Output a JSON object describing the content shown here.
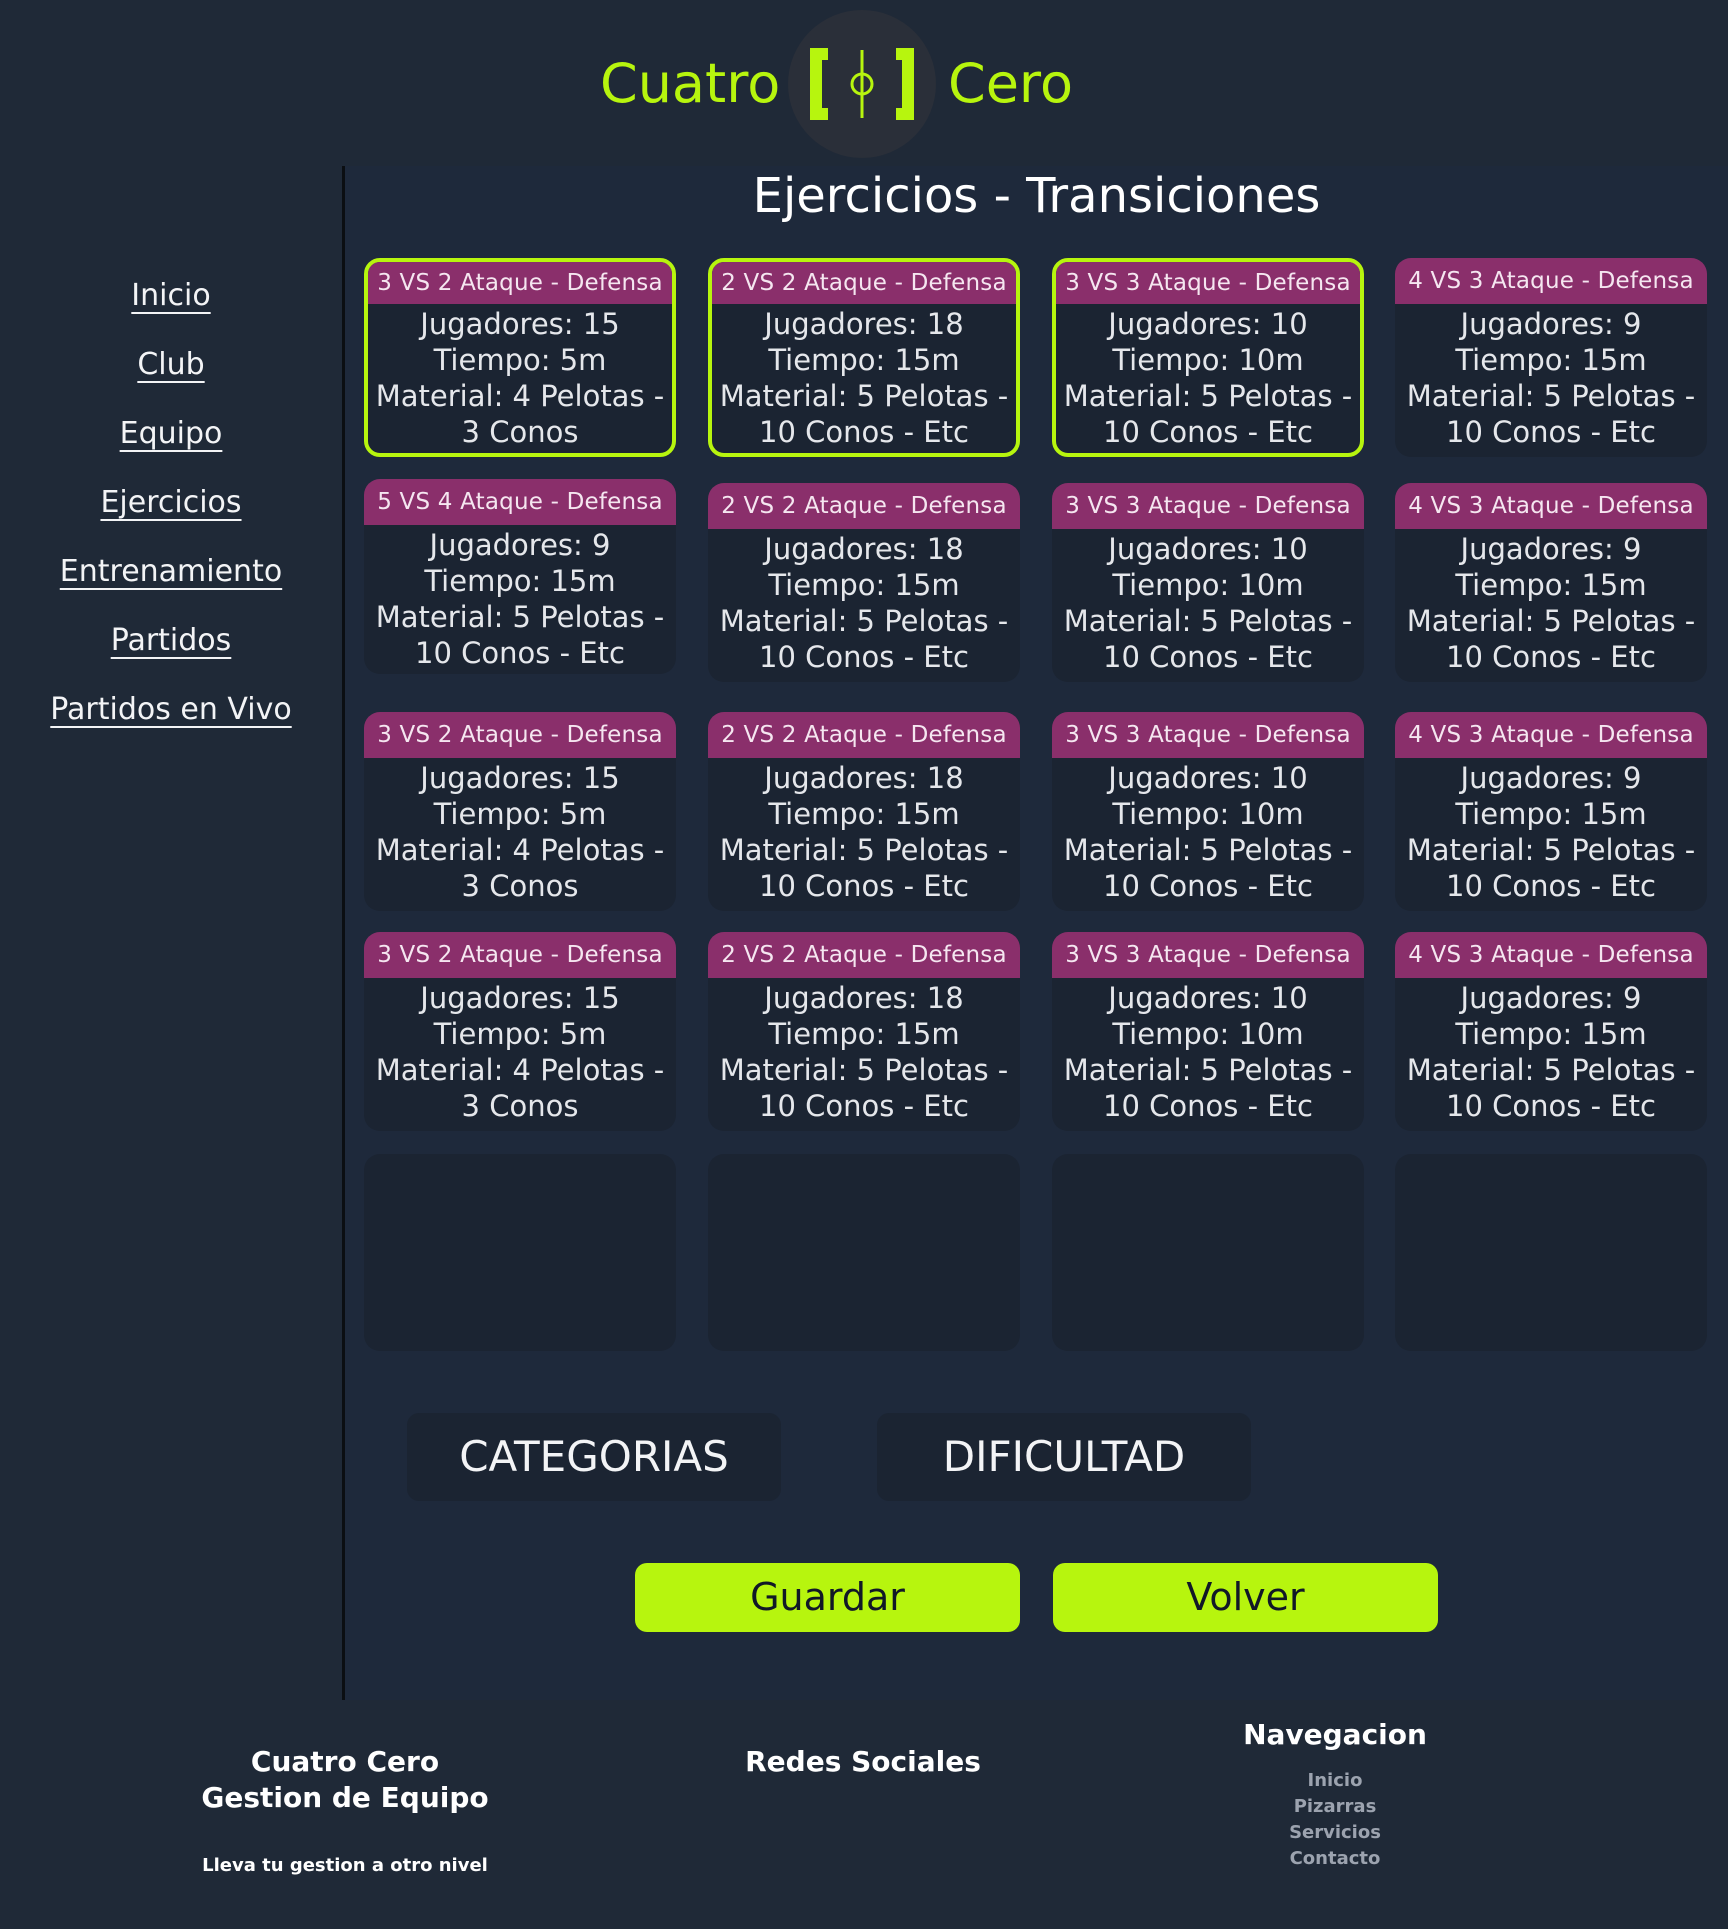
{
  "brand": {
    "left": "Cuatro",
    "right": "Cero",
    "accent": "#b7f50e",
    "logo_icon": "goal-brackets-icon"
  },
  "page": {
    "title": "Ejercicios - Transiciones"
  },
  "sidebar": {
    "items": [
      {
        "label": "Inicio"
      },
      {
        "label": "Club"
      },
      {
        "label": "Equipo"
      },
      {
        "label": "Ejercicios"
      },
      {
        "label": "Entrenamiento"
      },
      {
        "label": "Partidos"
      },
      {
        "label": "Partidos en Vivo"
      }
    ]
  },
  "exercises": [
    {
      "title": "3 VS 2 Ataque - Defensa",
      "jugadores": "Jugadores: 15",
      "tiempo": "Tiempo: 5m",
      "material1": "Material: 4 Pelotas -",
      "material2": "3 Conos",
      "selected": true
    },
    {
      "title": "2 VS 2 Ataque - Defensa",
      "jugadores": "Jugadores: 18",
      "tiempo": "Tiempo: 15m",
      "material1": "Material: 5 Pelotas -",
      "material2": "10 Conos - Etc",
      "selected": true
    },
    {
      "title": "3 VS 3 Ataque - Defensa",
      "jugadores": "Jugadores: 10",
      "tiempo": "Tiempo: 10m",
      "material1": "Material: 5 Pelotas -",
      "material2": "10 Conos - Etc",
      "selected": true
    },
    {
      "title": "4 VS 3 Ataque - Defensa",
      "jugadores": "Jugadores: 9",
      "tiempo": "Tiempo: 15m",
      "material1": "Material: 5 Pelotas -",
      "material2": "10 Conos - Etc",
      "selected": false
    },
    {
      "title": "5 VS 4 Ataque - Defensa",
      "jugadores": "Jugadores: 9",
      "tiempo": "Tiempo: 15m",
      "material1": "Material: 5 Pelotas -",
      "material2": "10 Conos - Etc",
      "selected": false
    },
    {
      "title": "2 VS 2 Ataque - Defensa",
      "jugadores": "Jugadores: 18",
      "tiempo": "Tiempo: 15m",
      "material1": "Material: 5 Pelotas -",
      "material2": "10 Conos - Etc",
      "selected": false
    },
    {
      "title": "3 VS 3 Ataque - Defensa",
      "jugadores": "Jugadores: 10",
      "tiempo": "Tiempo: 10m",
      "material1": "Material: 5 Pelotas -",
      "material2": "10 Conos - Etc",
      "selected": false
    },
    {
      "title": "4 VS 3 Ataque - Defensa",
      "jugadores": "Jugadores: 9",
      "tiempo": "Tiempo: 15m",
      "material1": "Material: 5 Pelotas -",
      "material2": "10 Conos - Etc",
      "selected": false
    },
    {
      "title": "3 VS 2 Ataque - Defensa",
      "jugadores": "Jugadores: 15",
      "tiempo": "Tiempo: 5m",
      "material1": "Material: 4 Pelotas -",
      "material2": "3 Conos",
      "selected": false
    },
    {
      "title": "2 VS 2 Ataque - Defensa",
      "jugadores": "Jugadores: 18",
      "tiempo": "Tiempo: 15m",
      "material1": "Material: 5 Pelotas -",
      "material2": "10 Conos - Etc",
      "selected": false
    },
    {
      "title": "3 VS 3 Ataque - Defensa",
      "jugadores": "Jugadores: 10",
      "tiempo": "Tiempo: 10m",
      "material1": "Material: 5 Pelotas -",
      "material2": "10 Conos - Etc",
      "selected": false
    },
    {
      "title": "4 VS 3 Ataque - Defensa",
      "jugadores": "Jugadores: 9",
      "tiempo": "Tiempo: 15m",
      "material1": "Material: 5 Pelotas -",
      "material2": "10 Conos - Etc",
      "selected": false
    },
    {
      "title": "3 VS 2 Ataque - Defensa",
      "jugadores": "Jugadores: 15",
      "tiempo": "Tiempo: 5m",
      "material1": "Material: 4 Pelotas -",
      "material2": "3 Conos",
      "selected": false
    },
    {
      "title": "2 VS 2 Ataque - Defensa",
      "jugadores": "Jugadores: 18",
      "tiempo": "Tiempo: 15m",
      "material1": "Material: 5 Pelotas -",
      "material2": "10 Conos - Etc",
      "selected": false
    },
    {
      "title": "3 VS 3 Ataque - Defensa",
      "jugadores": "Jugadores: 10",
      "tiempo": "Tiempo: 10m",
      "material1": "Material: 5 Pelotas -",
      "material2": "10 Conos - Etc",
      "selected": false
    },
    {
      "title": "4 VS 3 Ataque - Defensa",
      "jugadores": "Jugadores: 9",
      "tiempo": "Tiempo: 15m",
      "material1": "Material: 5 Pelotas -",
      "material2": "10 Conos - Etc",
      "selected": false
    }
  ],
  "filters": {
    "categorias": "CATEGORIAS",
    "dificultad": "DIFICULTAD"
  },
  "actions": {
    "guardar": "Guardar",
    "volver": "Volver"
  },
  "footer": {
    "brand_line1": "Cuatro Cero",
    "brand_line2": "Gestion de Equipo",
    "tagline": "Lleva tu gestion a otro nivel",
    "social_title": "Redes Sociales",
    "nav_title": "Navegacion",
    "nav_links": [
      "Inicio",
      "Pizarras",
      "Servicios",
      "Contacto"
    ]
  },
  "colors": {
    "card_header": "#8a2f6b",
    "selected_border": "#b7f50e",
    "background": "#1f2937",
    "panel": "#1e293b"
  }
}
